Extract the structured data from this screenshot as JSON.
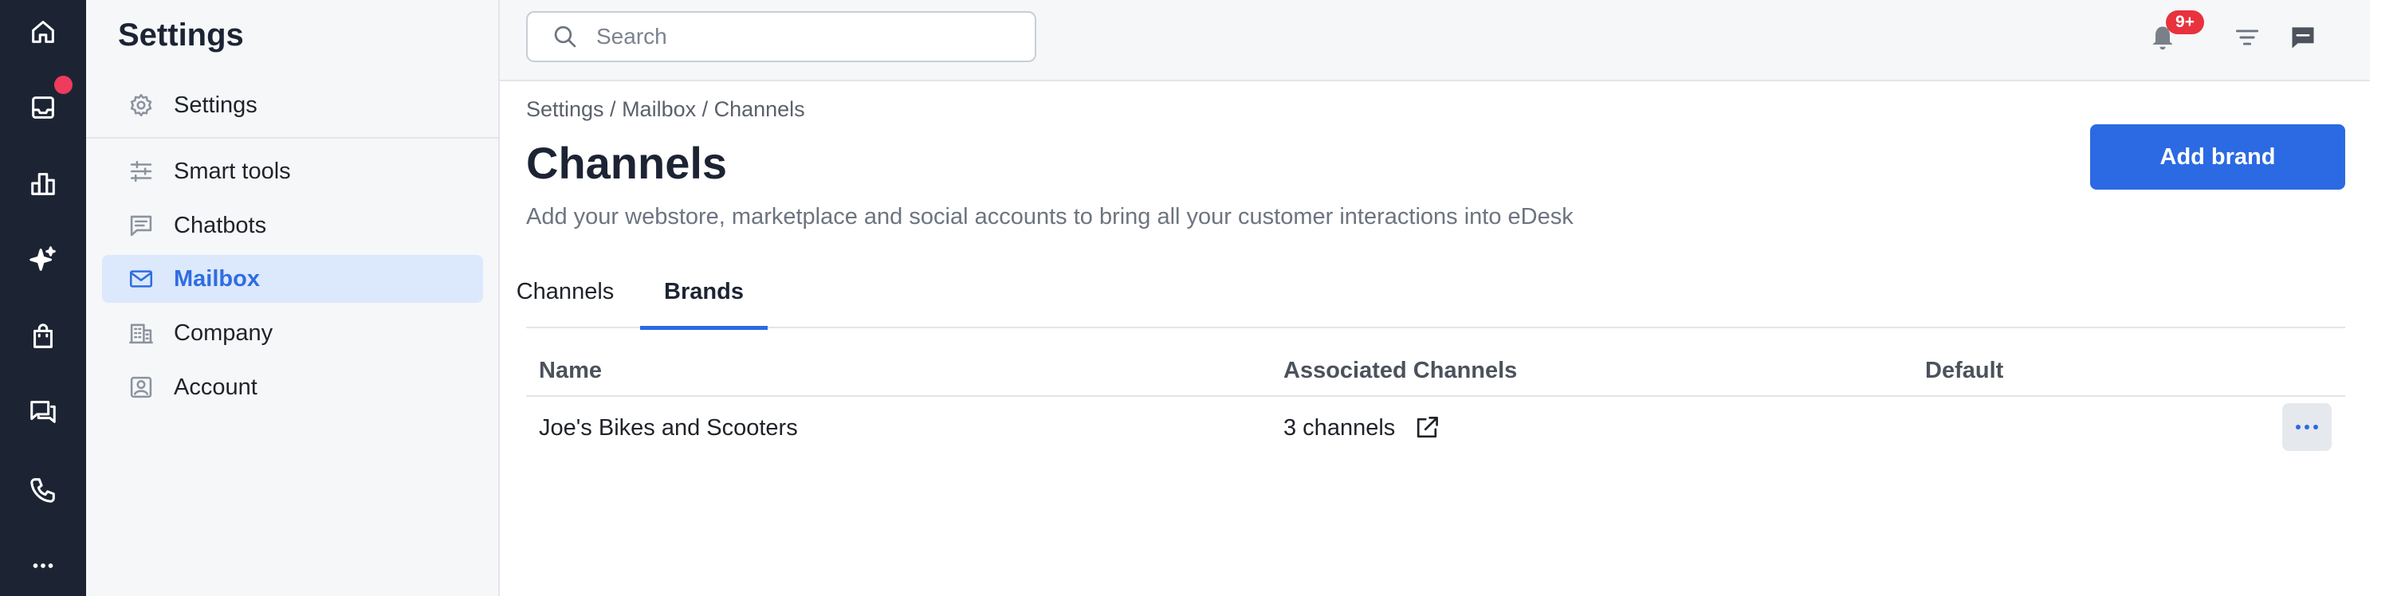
{
  "rail": {
    "items": [
      {
        "icon": "home-icon"
      },
      {
        "icon": "inbox-icon",
        "has_notification_dot": true
      },
      {
        "icon": "reports-icon"
      },
      {
        "icon": "ai-sparkle-icon"
      },
      {
        "icon": "orders-bag-icon"
      },
      {
        "icon": "chat-icon"
      },
      {
        "icon": "phone-icon"
      },
      {
        "icon": "more-icon"
      }
    ]
  },
  "sidebar": {
    "title": "Settings",
    "items": [
      {
        "label": "Settings",
        "icon": "gear-icon"
      },
      {
        "label": "Smart tools",
        "icon": "sliders-icon"
      },
      {
        "label": "Chatbots",
        "icon": "chat-bubble-icon"
      },
      {
        "label": "Mailbox",
        "icon": "mail-icon",
        "active": true
      },
      {
        "label": "Company",
        "icon": "building-icon"
      },
      {
        "label": "Account",
        "icon": "account-icon"
      }
    ]
  },
  "topbar": {
    "search_placeholder": "Search",
    "notification_badge": "9+"
  },
  "main": {
    "breadcrumb": "Settings / Mailbox / Channels",
    "title": "Channels",
    "description": "Add your webstore, marketplace and social accounts to bring all your customer interactions into eDesk",
    "add_button": "Add brand",
    "tabs": [
      {
        "label": "Channels",
        "active": false
      },
      {
        "label": "Brands",
        "active": true
      }
    ],
    "table": {
      "columns": [
        "Name",
        "Associated Channels",
        "Default"
      ],
      "rows": [
        {
          "name": "Joe's Bikes and Scooters",
          "channels": "3 channels",
          "default": ""
        }
      ]
    }
  },
  "colors": {
    "rail_bg": "#1c2434",
    "accent": "#2b6ae2",
    "active_bg": "#dce8fb",
    "badge": "#e8323d"
  }
}
